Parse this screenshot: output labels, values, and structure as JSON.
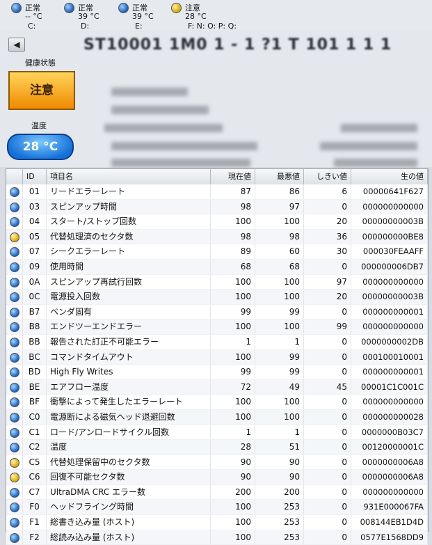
{
  "drives": [
    {
      "status": "正常",
      "temp": "-- °C",
      "letter": "C:",
      "color": "blue"
    },
    {
      "status": "正常",
      "temp": "39 °C",
      "letter": "D:",
      "color": "blue"
    },
    {
      "status": "正常",
      "temp": "39 °C",
      "letter": "E:",
      "color": "blue"
    },
    {
      "status": "注意",
      "temp": "28 °C",
      "letter": "F: N: O: P: Q:",
      "color": "yellow"
    }
  ],
  "header": {
    "back_icon": "◀",
    "model_title": "ST10001 1M0 1 - 1 ?1 T  101 1 1 1",
    "health_label": "健康状態",
    "health_value": "注意",
    "temp_label": "温度",
    "temp_value": "28 °C"
  },
  "table": {
    "columns": {
      "id": "ID",
      "name": "項目名",
      "current": "現在値",
      "worst": "最悪値",
      "threshold": "しきい値",
      "raw": "生の値"
    },
    "rows": [
      {
        "status": "good",
        "id": "01",
        "name": "リードエラーレート",
        "current": "87",
        "worst": "86",
        "threshold": "6",
        "raw": "00000641F627"
      },
      {
        "status": "good",
        "id": "03",
        "name": "スピンアップ時間",
        "current": "98",
        "worst": "97",
        "threshold": "0",
        "raw": "000000000000"
      },
      {
        "status": "good",
        "id": "04",
        "name": "スタート/ストップ回数",
        "current": "100",
        "worst": "100",
        "threshold": "20",
        "raw": "00000000003B"
      },
      {
        "status": "caution",
        "id": "05",
        "name": "代替処理済のセクタ数",
        "current": "98",
        "worst": "98",
        "threshold": "36",
        "raw": "000000000BE8"
      },
      {
        "status": "good",
        "id": "07",
        "name": "シークエラーレート",
        "current": "89",
        "worst": "60",
        "threshold": "30",
        "raw": "000030FEAAFF"
      },
      {
        "status": "good",
        "id": "09",
        "name": "使用時間",
        "current": "68",
        "worst": "68",
        "threshold": "0",
        "raw": "000000006DB7"
      },
      {
        "status": "good",
        "id": "0A",
        "name": "スピンアップ再試行回数",
        "current": "100",
        "worst": "100",
        "threshold": "97",
        "raw": "000000000000"
      },
      {
        "status": "good",
        "id": "0C",
        "name": "電源投入回数",
        "current": "100",
        "worst": "100",
        "threshold": "20",
        "raw": "00000000003B"
      },
      {
        "status": "good",
        "id": "B7",
        "name": "ベンダ固有",
        "current": "99",
        "worst": "99",
        "threshold": "0",
        "raw": "000000000001"
      },
      {
        "status": "good",
        "id": "B8",
        "name": "エンドツーエンドエラー",
        "current": "100",
        "worst": "100",
        "threshold": "99",
        "raw": "000000000000"
      },
      {
        "status": "good",
        "id": "BB",
        "name": "報告された訂正不可能エラー",
        "current": "1",
        "worst": "1",
        "threshold": "0",
        "raw": "0000000002DB"
      },
      {
        "status": "good",
        "id": "BC",
        "name": "コマンドタイムアウト",
        "current": "100",
        "worst": "99",
        "threshold": "0",
        "raw": "000100010001"
      },
      {
        "status": "good",
        "id": "BD",
        "name": "High Fly Writes",
        "current": "99",
        "worst": "99",
        "threshold": "0",
        "raw": "000000000001"
      },
      {
        "status": "good",
        "id": "BE",
        "name": "エアフロー温度",
        "current": "72",
        "worst": "49",
        "threshold": "45",
        "raw": "00001C1C001C"
      },
      {
        "status": "good",
        "id": "BF",
        "name": "衝撃によって発生したエラーレート",
        "current": "100",
        "worst": "100",
        "threshold": "0",
        "raw": "000000000000"
      },
      {
        "status": "good",
        "id": "C0",
        "name": "電源断による磁気ヘッド退避回数",
        "current": "100",
        "worst": "100",
        "threshold": "0",
        "raw": "000000000028"
      },
      {
        "status": "good",
        "id": "C1",
        "name": "ロード/アンロードサイクル回数",
        "current": "1",
        "worst": "1",
        "threshold": "0",
        "raw": "0000000B03C7"
      },
      {
        "status": "good",
        "id": "C2",
        "name": "温度",
        "current": "28",
        "worst": "51",
        "threshold": "0",
        "raw": "00120000001C"
      },
      {
        "status": "caution",
        "id": "C5",
        "name": "代替処理保留中のセクタ数",
        "current": "90",
        "worst": "90",
        "threshold": "0",
        "raw": "0000000006A8"
      },
      {
        "status": "caution",
        "id": "C6",
        "name": "回復不可能セクタ数",
        "current": "90",
        "worst": "90",
        "threshold": "0",
        "raw": "0000000006A8"
      },
      {
        "status": "good",
        "id": "C7",
        "name": "UltraDMA CRC エラー数",
        "current": "200",
        "worst": "200",
        "threshold": "0",
        "raw": "000000000000"
      },
      {
        "status": "good",
        "id": "F0",
        "name": "ヘッドフライング時間",
        "current": "100",
        "worst": "253",
        "threshold": "0",
        "raw": "931E000067FA"
      },
      {
        "status": "good",
        "id": "F1",
        "name": "総書き込み量 (ホスト)",
        "current": "100",
        "worst": "253",
        "threshold": "0",
        "raw": "008144EB1D4D"
      },
      {
        "status": "good",
        "id": "F2",
        "name": "総読み込み量 (ホスト)",
        "current": "100",
        "worst": "253",
        "threshold": "0",
        "raw": "0577E1568DD9"
      }
    ]
  }
}
